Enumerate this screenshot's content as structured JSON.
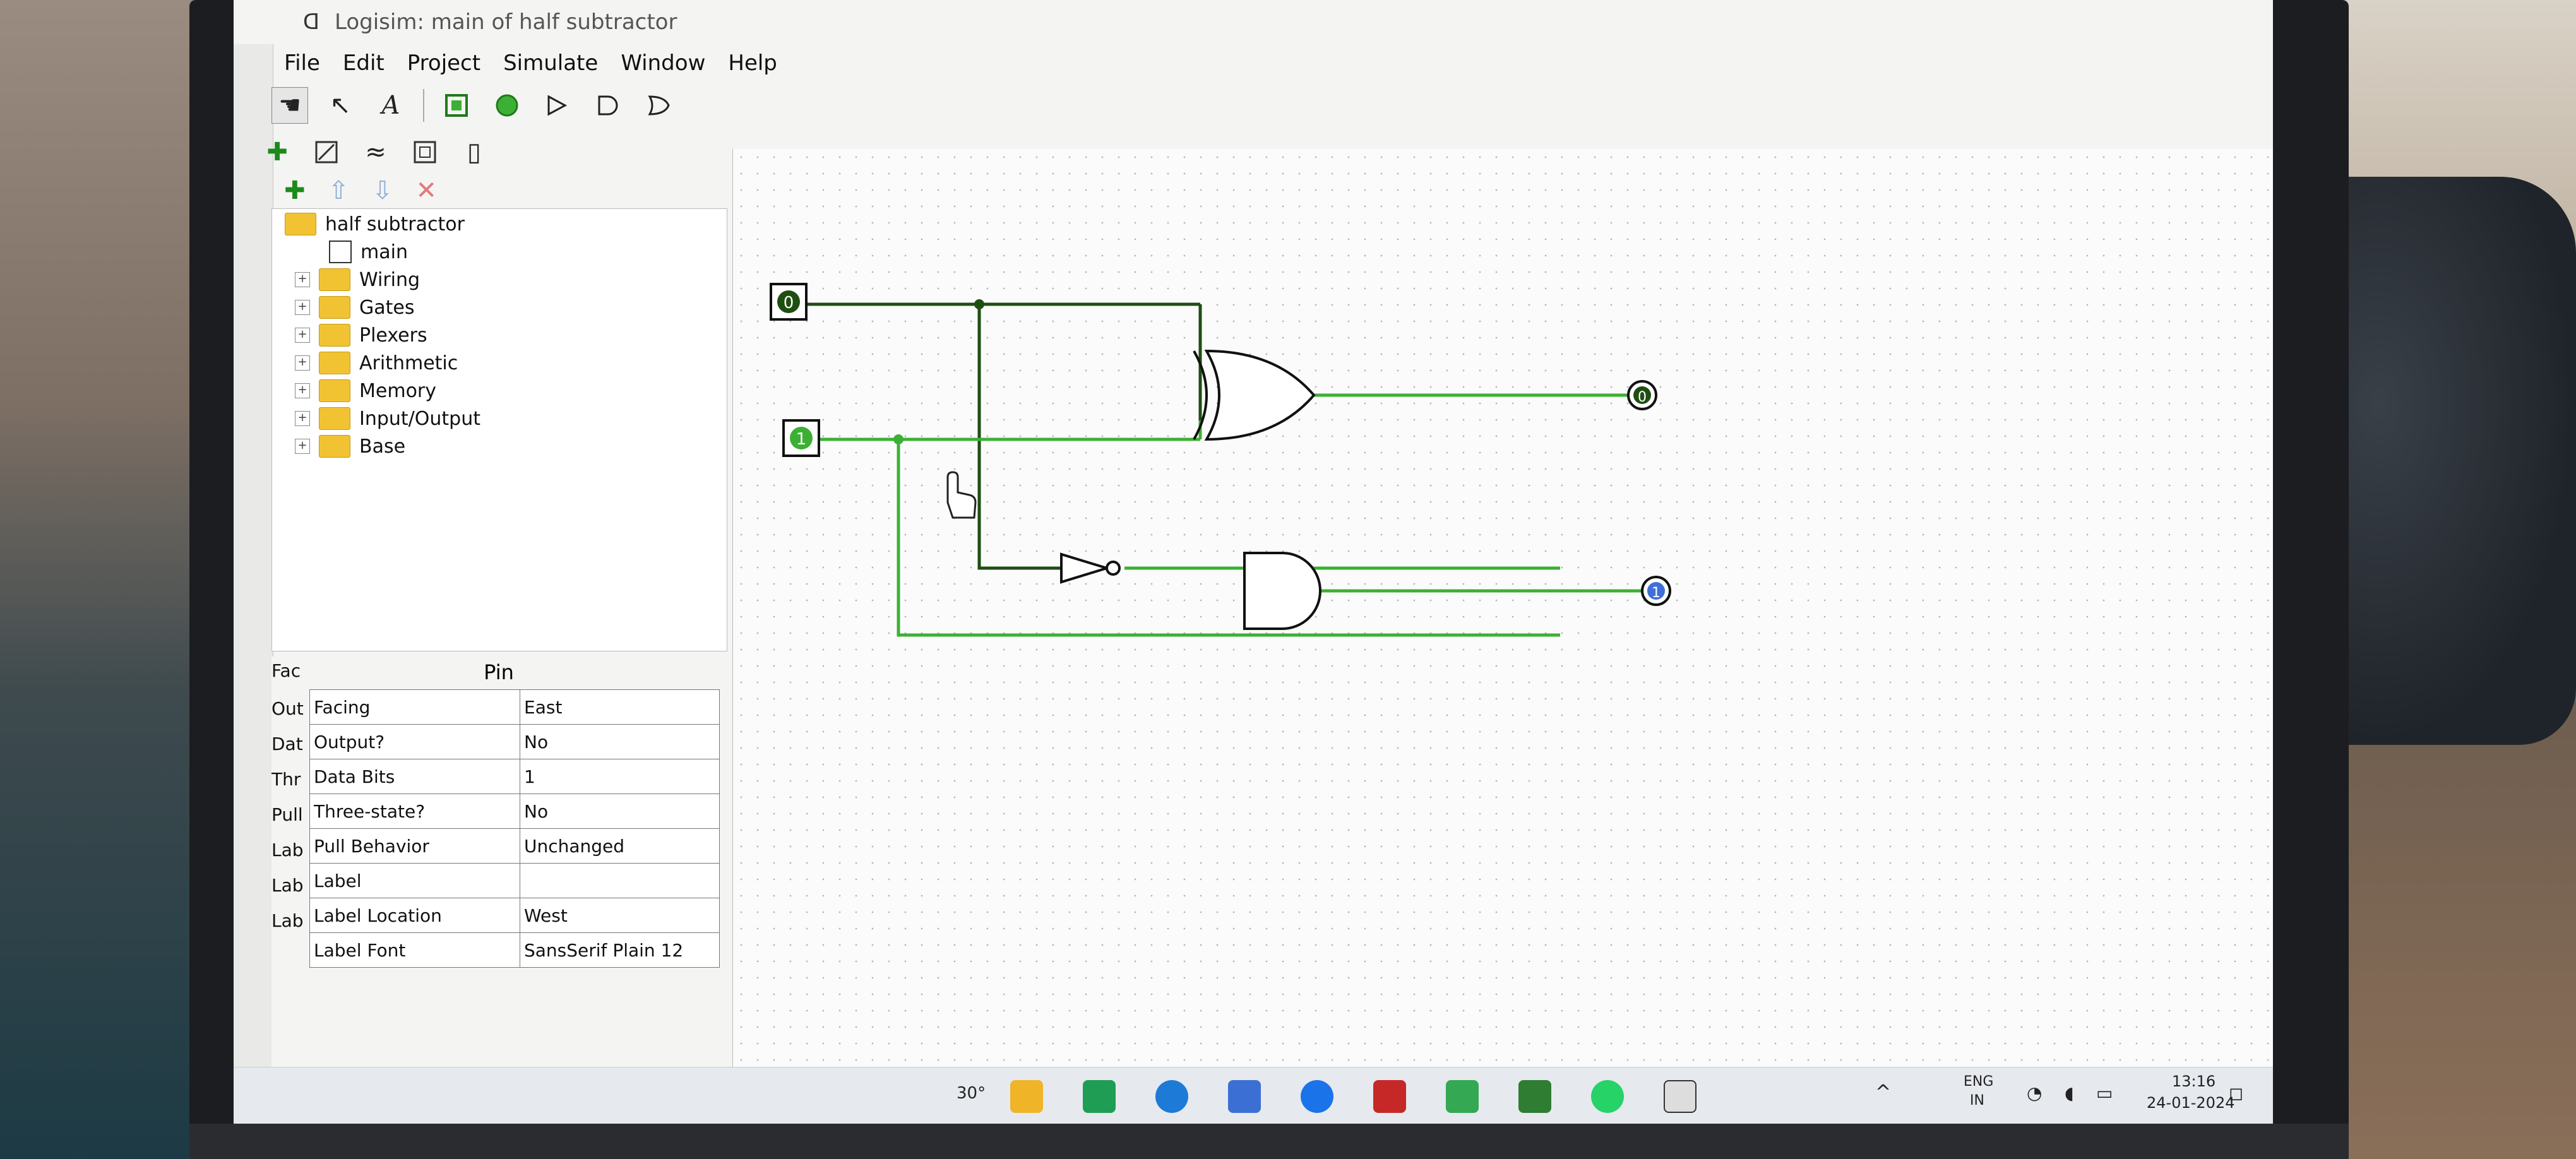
{
  "window": {
    "title": "Logisim: main of half subtractor"
  },
  "menubar": {
    "items": [
      "File",
      "Edit",
      "Project",
      "Simulate",
      "Window",
      "Help"
    ]
  },
  "explorer": {
    "project": "half subtractor",
    "circuit": "main",
    "libraries": [
      "Wiring",
      "Gates",
      "Plexers",
      "Arithmetic",
      "Memory",
      "Input/Output",
      "Base"
    ]
  },
  "attributes": {
    "title": "Pin",
    "rows": [
      {
        "label": "Facing",
        "value": "East"
      },
      {
        "label": "Output?",
        "value": "No"
      },
      {
        "label": "Data Bits",
        "value": "1"
      },
      {
        "label": "Three-state?",
        "value": "No"
      },
      {
        "label": "Pull Behavior",
        "value": "Unchanged"
      },
      {
        "label": "Label",
        "value": ""
      },
      {
        "label": "Label Location",
        "value": "West"
      },
      {
        "label": "Label Font",
        "value": "SansSerif Plain 12"
      }
    ],
    "cut_labels": [
      "Fac",
      "Out",
      "Dat",
      "Thr",
      "Pull",
      "Lab",
      "Lab",
      "Lab"
    ]
  },
  "circuit": {
    "input_a_value": "0",
    "input_b_value": "1",
    "difference_output_value": "0",
    "borrow_output_value": "1",
    "active_wire_color": "#3cb034",
    "inactive_wire_color": "#1f4e12"
  },
  "taskbar": {
    "weather": "30°",
    "language_top": "ENG",
    "language_bottom": "IN",
    "time": "13:16",
    "date": "24-01-2024"
  }
}
